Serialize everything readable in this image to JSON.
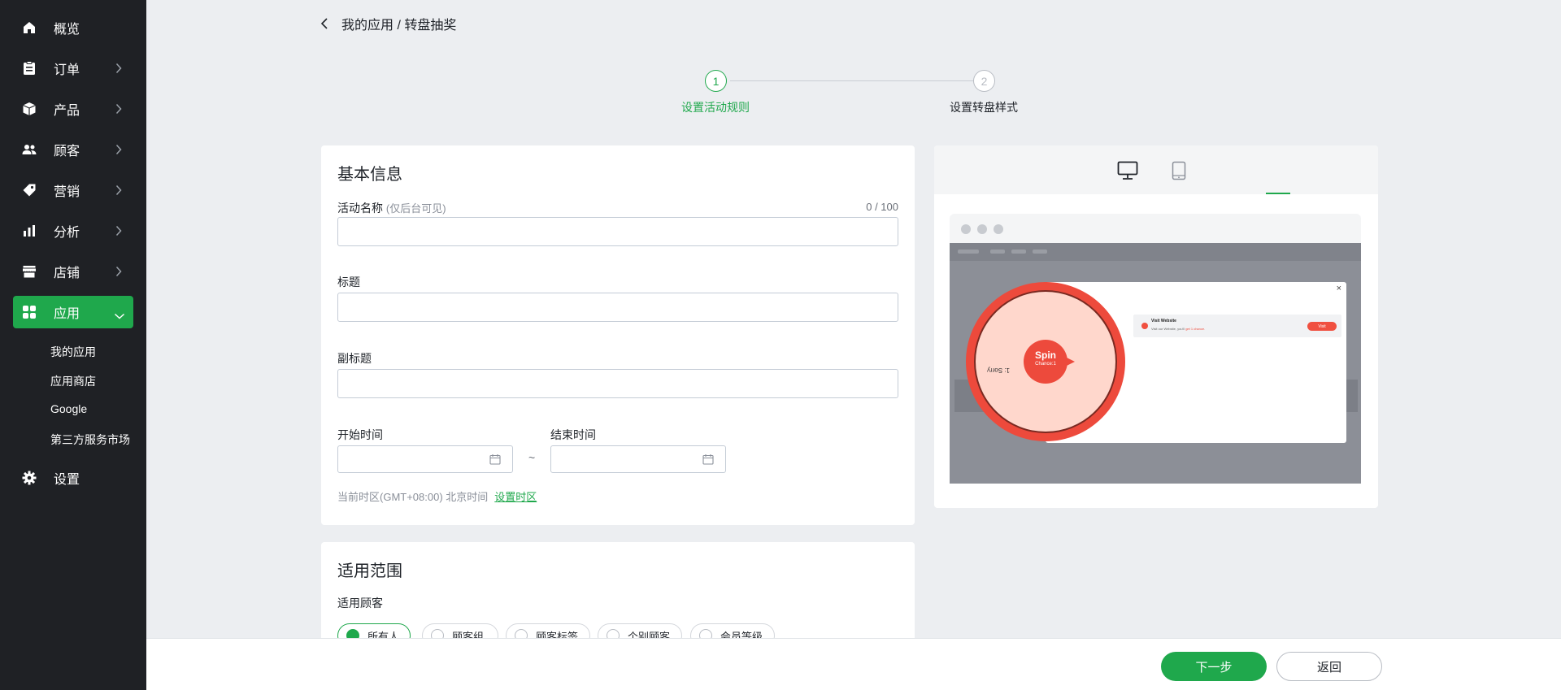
{
  "sidebar": {
    "items": [
      {
        "label": "概览",
        "icon": "home-icon"
      },
      {
        "label": "订单",
        "icon": "clipboard-icon"
      },
      {
        "label": "产品",
        "icon": "box-icon"
      },
      {
        "label": "顾客",
        "icon": "users-icon"
      },
      {
        "label": "营销",
        "icon": "tag-icon"
      },
      {
        "label": "分析",
        "icon": "bar-chart-icon"
      },
      {
        "label": "店铺",
        "icon": "store-icon"
      },
      {
        "label": "应用",
        "icon": "apps-icon"
      },
      {
        "label": "设置",
        "icon": "gear-icon"
      }
    ],
    "subitems": [
      "我的应用",
      "应用商店",
      "Google",
      "第三方服务市场"
    ]
  },
  "breadcrumb": "我的应用 / 转盘抽奖",
  "steps": [
    {
      "number": "1",
      "label": "设置活动规则",
      "active": true
    },
    {
      "number": "2",
      "label": "设置转盘样式",
      "active": false
    }
  ],
  "basic_info": {
    "title": "基本信息",
    "name_label": "活动名称",
    "name_hint": "(仅后台可见)",
    "name_counter": "0 / 100",
    "name_value": "",
    "title_label": "标题",
    "title_value": "",
    "subtitle_label": "副标题",
    "subtitle_value": "",
    "start_label": "开始时间",
    "end_label": "结束时间",
    "range_separator": "~",
    "timezone_text": "当前时区(GMT+08:00) 北京时间",
    "timezone_link": "设置时区"
  },
  "scope": {
    "title": "适用范围",
    "customer_label": "适用顾客",
    "options": [
      "所有人",
      "顾客组",
      "顾客标签",
      "个别顾客",
      "会员等级"
    ],
    "selected": "所有人"
  },
  "preview": {
    "tabs": [
      {
        "icon": "desktop-icon",
        "active": true
      },
      {
        "icon": "tablet-icon",
        "active": false
      }
    ],
    "wheel": {
      "center_label": "Spin",
      "chances_label": "Chance:1",
      "segment_label": "1: Sorry"
    },
    "task": {
      "title": "Visit Website",
      "desc_prefix": "Visit our Website, you'll",
      "desc_highlight": "get 1 chance.",
      "button": "Visit"
    },
    "close_symbol": "×"
  },
  "footer": {
    "next_label": "下一步",
    "back_label": "返回"
  },
  "colors": {
    "accent": "#1fa84c",
    "sidebar_bg": "#1f2125",
    "wheel_red": "#ed4a3c"
  }
}
